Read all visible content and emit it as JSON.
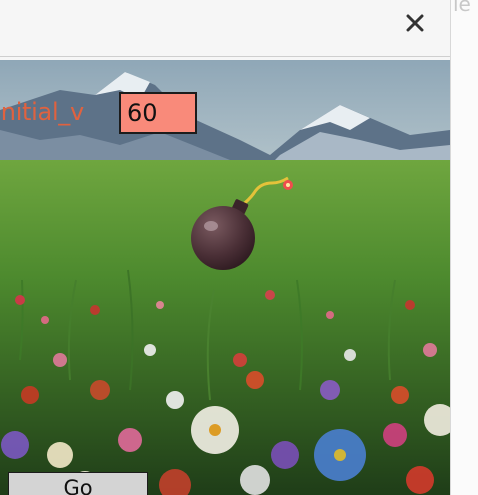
{
  "window": {
    "close_icon": "close-icon"
  },
  "controls": {
    "initial_v_label": "Initial_v",
    "initial_v_value": "60",
    "go_label": "Go"
  },
  "scene": {
    "background": "mountain-meadow-flowers",
    "sprite": "bomb-icon"
  },
  "colors": {
    "label": "#e0623f",
    "input_bg": "#f98a7a",
    "button_bg": "#d4d4d4"
  }
}
